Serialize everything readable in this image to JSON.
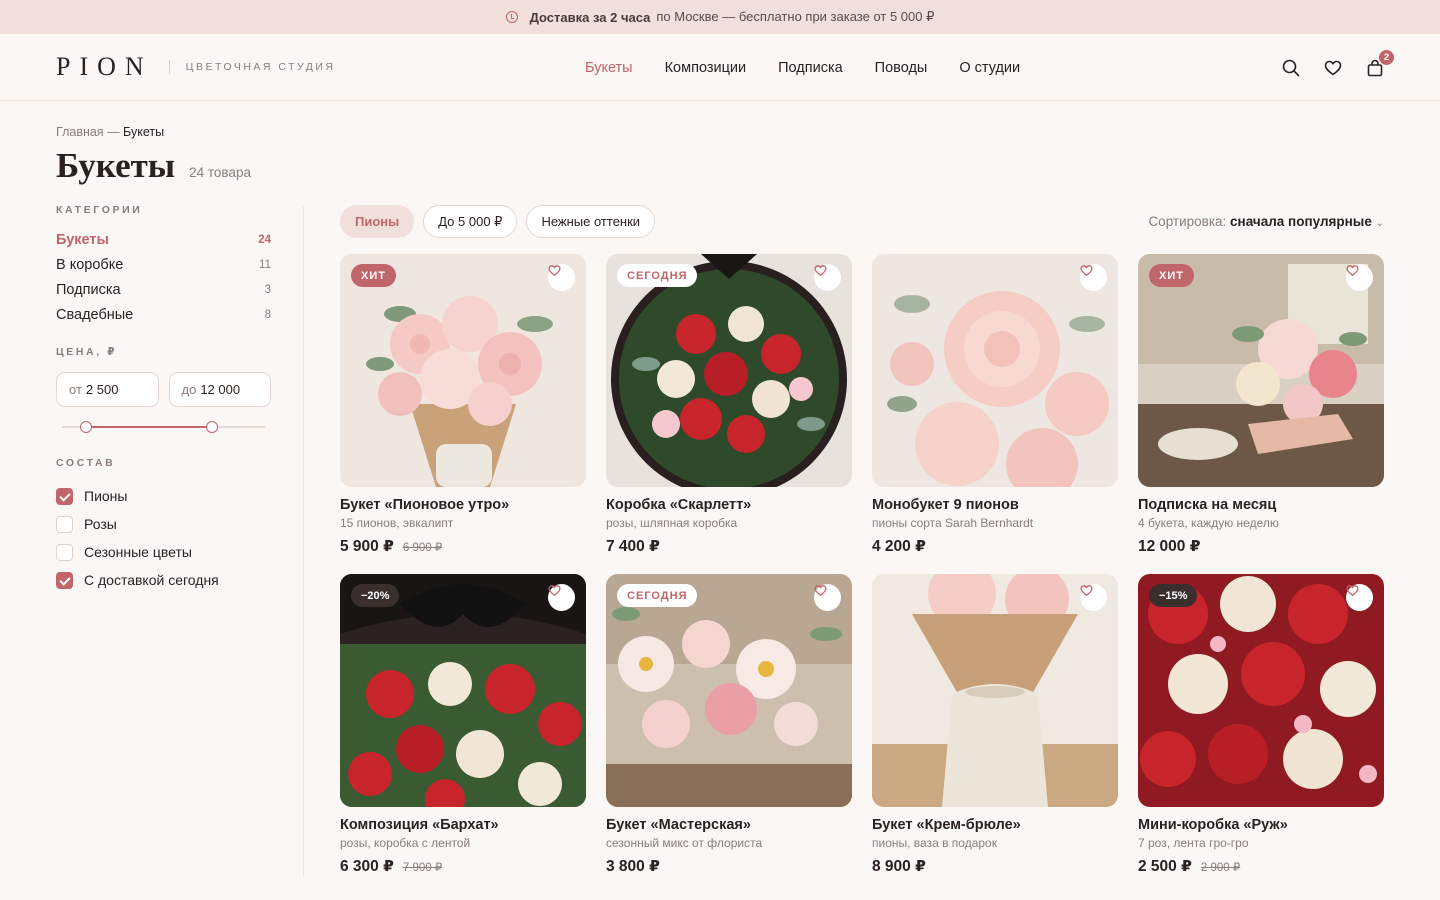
{
  "promo": {
    "bold1": "Доставка за 2 часа",
    "text": "по Москве — бесплатно при заказе от 5 000 ₽"
  },
  "header": {
    "logo": "PION",
    "tagline": "ЦВЕТОЧНАЯ СТУДИЯ",
    "nav": [
      "Букеты",
      "Композиции",
      "Подписка",
      "Поводы",
      "О студии"
    ],
    "cart_count": "2"
  },
  "breadcrumb": {
    "home": "Главная",
    "sep": "—",
    "current": "Букеты"
  },
  "page": {
    "title": "Букеты",
    "count": "24 товара"
  },
  "sidebar": {
    "categories_title": "КАТЕГОРИИ",
    "categories": [
      {
        "label": "Букеты",
        "count": "24"
      },
      {
        "label": "В коробке",
        "count": "11"
      },
      {
        "label": "Подписка",
        "count": "3"
      },
      {
        "label": "Свадебные",
        "count": "8"
      }
    ],
    "price_title": "ЦЕНА, ₽",
    "price_from_prefix": "от",
    "price_from": "2 500",
    "price_to_prefix": "до",
    "price_to": "12 000",
    "composition_title": "СОСТАВ",
    "composition": [
      {
        "label": "Пионы",
        "checked": true
      },
      {
        "label": "Розы",
        "checked": false
      },
      {
        "label": "Сезонные цветы",
        "checked": false
      },
      {
        "label": "С доставкой сегодня",
        "checked": true
      }
    ]
  },
  "filters": {
    "chips": [
      "Пионы",
      "До 5 000 ₽",
      "Нежные оттенки"
    ]
  },
  "sort": {
    "label": "Сортировка:",
    "value": "сначала популярные"
  },
  "products": [
    {
      "title": "Букет «Пионовое утро»",
      "sub": "15 пионов, эвкалипт",
      "price": "5 900 ₽",
      "old": "6 900 ₽",
      "tag": "ХИТ"
    },
    {
      "title": "Коробка «Скарлетт»",
      "sub": "розы, шляпная коробка",
      "price": "7 400 ₽",
      "old": "",
      "tag": "СЕГОДНЯ"
    },
    {
      "title": "Монобукет 9 пионов",
      "sub": "пионы сорта Sarah Bernhardt",
      "price": "4 200 ₽",
      "old": "",
      "tag": ""
    },
    {
      "title": "Подписка на месяц",
      "sub": "4 букета, каждую неделю",
      "price": "12 000 ₽",
      "old": "",
      "tag": "ХИТ"
    },
    {
      "title": "Композиция «Бархат»",
      "sub": "розы, коробка с лентой",
      "price": "6 300 ₽",
      "old": "7 900 ₽",
      "tag": "−20%"
    },
    {
      "title": "Букет «Мастерская»",
      "sub": "сезонный микс от флориста",
      "price": "3 800 ₽",
      "old": "",
      "tag": "СЕГОДНЯ"
    },
    {
      "title": "Букет «Крем-брюле»",
      "sub": "пионы, ваза в подарок",
      "price": "8 900 ₽",
      "old": "",
      "tag": ""
    },
    {
      "title": "Мини-коробка «Руж»",
      "sub": "7 роз, лента гро-гро",
      "price": "2 500 ₽",
      "old": "2 900 ₽",
      "tag": "−15%"
    }
  ],
  "colors": {
    "accent": "#c0656a",
    "promo_bg": "#f1dfdc",
    "page_bg": "#fbf7f4"
  }
}
